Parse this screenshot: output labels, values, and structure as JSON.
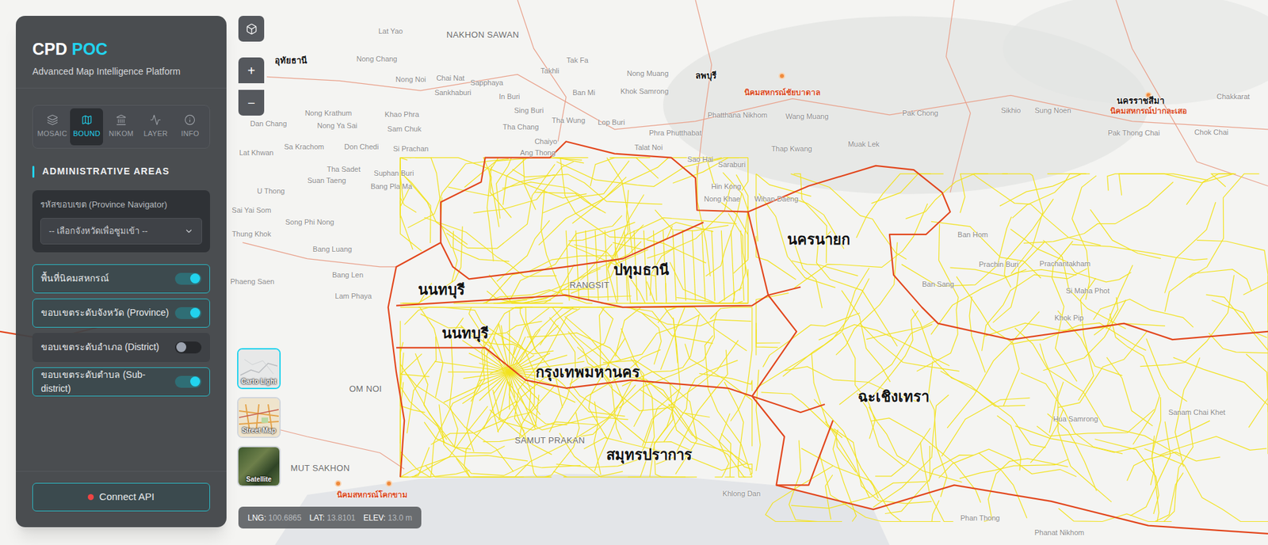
{
  "app": {
    "title": "CPD",
    "title_accent": "POC",
    "subtitle": "Advanced Map Intelligence Platform"
  },
  "tabs": [
    {
      "label": "MOSAIC",
      "selected": false
    },
    {
      "label": "BOUND",
      "selected": true
    },
    {
      "label": "NIKOM",
      "selected": false
    },
    {
      "label": "LAYER",
      "selected": false
    },
    {
      "label": "INFO",
      "selected": false
    }
  ],
  "section": {
    "title": "ADMINISTRATIVE AREAS"
  },
  "province_navigator": {
    "label": "รหัสขอบเขต (Province Navigator)",
    "placeholder": "-- เลือกจังหวัดเพื่อซูมเข้า --"
  },
  "layers": [
    {
      "label": "พื้นที่นิคมสหกรณ์",
      "on": true
    },
    {
      "label": "ขอบเขตระดับจังหวัด (Province)",
      "on": true
    },
    {
      "label": "ขอบเขตระดับอำเภอ (District)",
      "on": false
    },
    {
      "label": "ขอบเขตระดับตำบล (Sub-district)",
      "on": true
    }
  ],
  "connect_button": {
    "label": "Connect API",
    "connected": false
  },
  "map_controls": {
    "zoom_in": "+",
    "zoom_out": "−"
  },
  "basemaps": [
    {
      "label": "Carto Light",
      "selected": true
    },
    {
      "label": "Street Map",
      "selected": false
    },
    {
      "label": "Satellite",
      "selected": false
    }
  ],
  "coordinates": {
    "lng_label": "LNG:",
    "lng": "100.6865",
    "lat_label": "LAT:",
    "lat": "13.8101",
    "elev_label": "ELEV:",
    "elev": "13.0 m"
  },
  "map": {
    "province_labels": [
      {
        "text": "นนทบุรี",
        "kind": "major"
      },
      {
        "text": "นนทบุรี",
        "kind": "major"
      },
      {
        "text": "ปทุมธานี",
        "kind": "major"
      },
      {
        "text": "กรุงเทพมหานคร",
        "kind": "major"
      },
      {
        "text": "ฉะเชิงเทรา",
        "kind": "major"
      },
      {
        "text": "สมุทรปราการ",
        "kind": "major"
      },
      {
        "text": "นครนายก",
        "kind": "major"
      },
      {
        "text": "ลพบุรี",
        "kind": "minor"
      },
      {
        "text": "อุทัยธานี",
        "kind": "minor"
      },
      {
        "text": "นครราชสีมา",
        "kind": "minor"
      }
    ],
    "nikom_labels": [
      {
        "text": "นิคมสหกรณ์ชัยบาดาล"
      },
      {
        "text": "นิคมสหกรณ์ปากละเสอ"
      },
      {
        "text": "นิคมสหกรณ์โคกขาม"
      }
    ],
    "place_labels": [
      {
        "text": "NAKHON SAWAN",
        "kind": "city"
      },
      {
        "text": "Lat Yao",
        "kind": "town"
      },
      {
        "text": "Nong Chang",
        "kind": "town"
      },
      {
        "text": "Nong Noi",
        "kind": "town"
      },
      {
        "text": "Chai Nat",
        "kind": "town"
      },
      {
        "text": "Sapphaya",
        "kind": "town"
      },
      {
        "text": "Sankhaburi",
        "kind": "town"
      },
      {
        "text": "In Buri",
        "kind": "town"
      },
      {
        "text": "Takhli",
        "kind": "town"
      },
      {
        "text": "Tak Fa",
        "kind": "town"
      },
      {
        "text": "Nong Muang",
        "kind": "town"
      },
      {
        "text": "Khok Samrong",
        "kind": "town"
      },
      {
        "text": "Ban Mi",
        "kind": "town"
      },
      {
        "text": "Sing Buri",
        "kind": "town"
      },
      {
        "text": "Tha Wung",
        "kind": "town"
      },
      {
        "text": "Lop Buri",
        "kind": "town"
      },
      {
        "text": "Tha Chang",
        "kind": "town"
      },
      {
        "text": "Chaiyo",
        "kind": "town"
      },
      {
        "text": "Ang Thong",
        "kind": "town"
      },
      {
        "text": "Phra Phutthabat",
        "kind": "town"
      },
      {
        "text": "Talat Noi",
        "kind": "town"
      },
      {
        "text": "Sao Hai",
        "kind": "town"
      },
      {
        "text": "Saraburi",
        "kind": "town"
      },
      {
        "text": "Hin Kong",
        "kind": "town"
      },
      {
        "text": "Nong Khae",
        "kind": "town"
      },
      {
        "text": "Wihan Daeng",
        "kind": "town"
      },
      {
        "text": "Phatthana Nikhom",
        "kind": "town"
      },
      {
        "text": "Wang Muang",
        "kind": "town"
      },
      {
        "text": "Thap Kwang",
        "kind": "town"
      },
      {
        "text": "Muak Lek",
        "kind": "town"
      },
      {
        "text": "Pak Chong",
        "kind": "town"
      },
      {
        "text": "Sikhio",
        "kind": "town"
      },
      {
        "text": "Sung Noen",
        "kind": "town"
      },
      {
        "text": "Pak Thong Chai",
        "kind": "town"
      },
      {
        "text": "Chok Chai",
        "kind": "town"
      },
      {
        "text": "Chakkarat",
        "kind": "town"
      },
      {
        "text": "Dan Chang",
        "kind": "town"
      },
      {
        "text": "Nong Krathum",
        "kind": "town"
      },
      {
        "text": "Khao Phra",
        "kind": "town"
      },
      {
        "text": "Nong Ya Sai",
        "kind": "town"
      },
      {
        "text": "Sam Chuk",
        "kind": "town"
      },
      {
        "text": "Sa Krachom",
        "kind": "town"
      },
      {
        "text": "Don Chedi",
        "kind": "town"
      },
      {
        "text": "Si Prachan",
        "kind": "town"
      },
      {
        "text": "Lat Khwan",
        "kind": "town"
      },
      {
        "text": "Tha Sadet",
        "kind": "town"
      },
      {
        "text": "Suphan Buri",
        "kind": "town"
      },
      {
        "text": "Suan Taeng",
        "kind": "town"
      },
      {
        "text": "Bang Pla Ma",
        "kind": "town"
      },
      {
        "text": "U Thong",
        "kind": "town"
      },
      {
        "text": "Sai Yai Som",
        "kind": "town"
      },
      {
        "text": "Song Phi Nong",
        "kind": "town"
      },
      {
        "text": "Thung Khok",
        "kind": "town"
      },
      {
        "text": "Bang Luang",
        "kind": "town"
      },
      {
        "text": "Bang Len",
        "kind": "town"
      },
      {
        "text": "Phaeng Saen",
        "kind": "town"
      },
      {
        "text": "Lam Phaya",
        "kind": "town"
      },
      {
        "text": "OM NOI",
        "kind": "city"
      },
      {
        "text": "MUT SAKHON",
        "kind": "city"
      },
      {
        "text": "Ban Hom",
        "kind": "town"
      },
      {
        "text": "Prachin Buri",
        "kind": "town"
      },
      {
        "text": "Prachantakham",
        "kind": "town"
      },
      {
        "text": "Ban Sang",
        "kind": "town"
      },
      {
        "text": "Si Maha Phot",
        "kind": "town"
      },
      {
        "text": "Khok Pip",
        "kind": "town"
      },
      {
        "text": "Hua Samrong",
        "kind": "town"
      },
      {
        "text": "Sanam Chai Khet",
        "kind": "town"
      },
      {
        "text": "Khlong Dan",
        "kind": "town"
      },
      {
        "text": "Phan Thong",
        "kind": "town"
      },
      {
        "text": "Phanat Nikhom",
        "kind": "town"
      },
      {
        "text": "RANGSIT",
        "kind": "city"
      },
      {
        "text": "SAMUT PRAKAN",
        "kind": "city"
      }
    ]
  }
}
